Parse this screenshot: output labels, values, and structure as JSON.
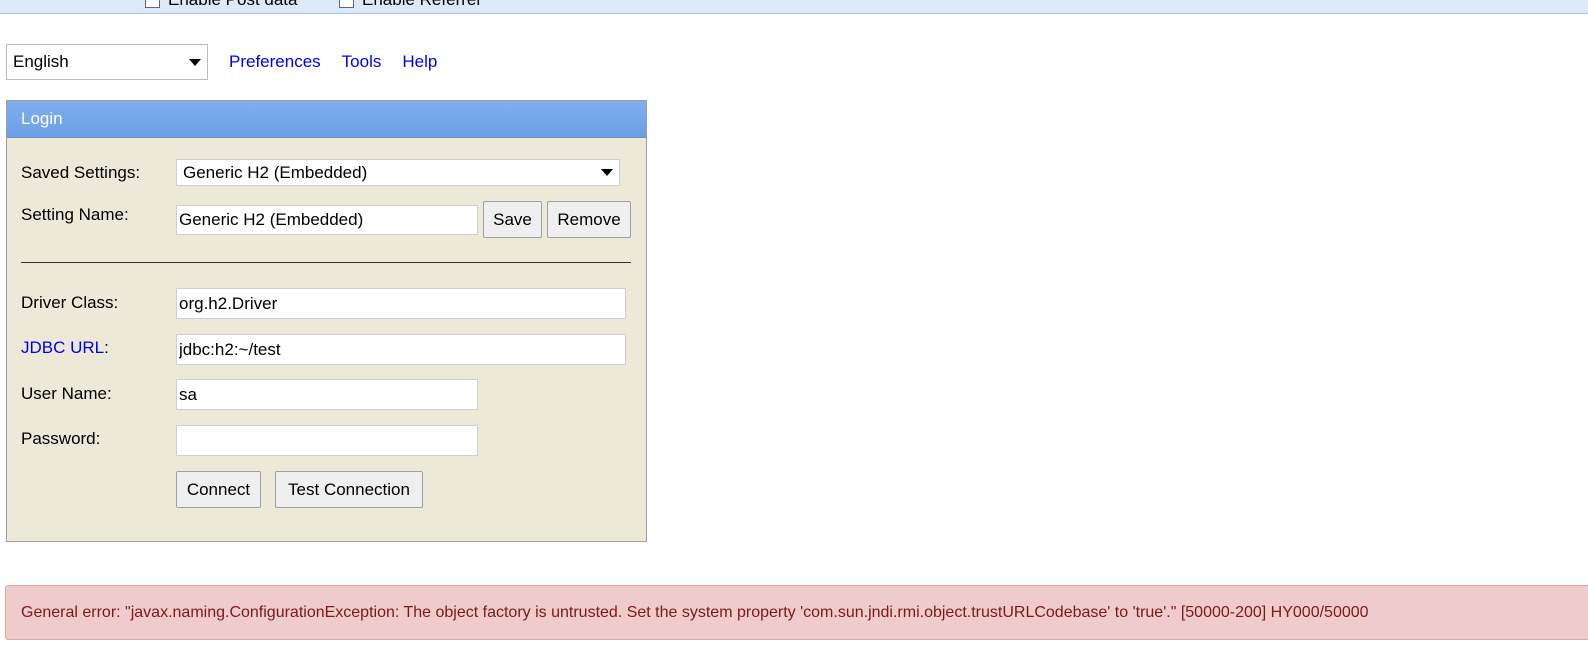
{
  "toolbar": {
    "enable_post_data": "Enable Post data",
    "enable_referrer": "Enable Referrer"
  },
  "language": {
    "selected": "English"
  },
  "nav": {
    "preferences": "Preferences",
    "tools": "Tools",
    "help": "Help"
  },
  "login": {
    "title": "Login",
    "saved_settings_label": "Saved Settings:",
    "saved_settings_value": "Generic H2 (Embedded)",
    "setting_name_label": "Setting Name:",
    "setting_name_value": "Generic H2 (Embedded)",
    "save_label": "Save",
    "remove_label": "Remove",
    "driver_class_label": "Driver Class:",
    "driver_class_value": "org.h2.Driver",
    "jdbc_url_link": "JDBC URL",
    "jdbc_url_colon": ":",
    "jdbc_url_value": "jdbc:h2:~/test",
    "user_name_label": "User Name:",
    "user_name_value": "sa",
    "password_label": "Password:",
    "password_value": "",
    "connect_label": "Connect",
    "test_connection_label": "Test Connection"
  },
  "error": {
    "message": "General error: \"javax.naming.ConfigurationException: The object factory is untrusted. Set the system property 'com.sun.jndi.rmi.object.trustURLCodebase' to 'true'.\" [50000-200] HY000/50000"
  }
}
